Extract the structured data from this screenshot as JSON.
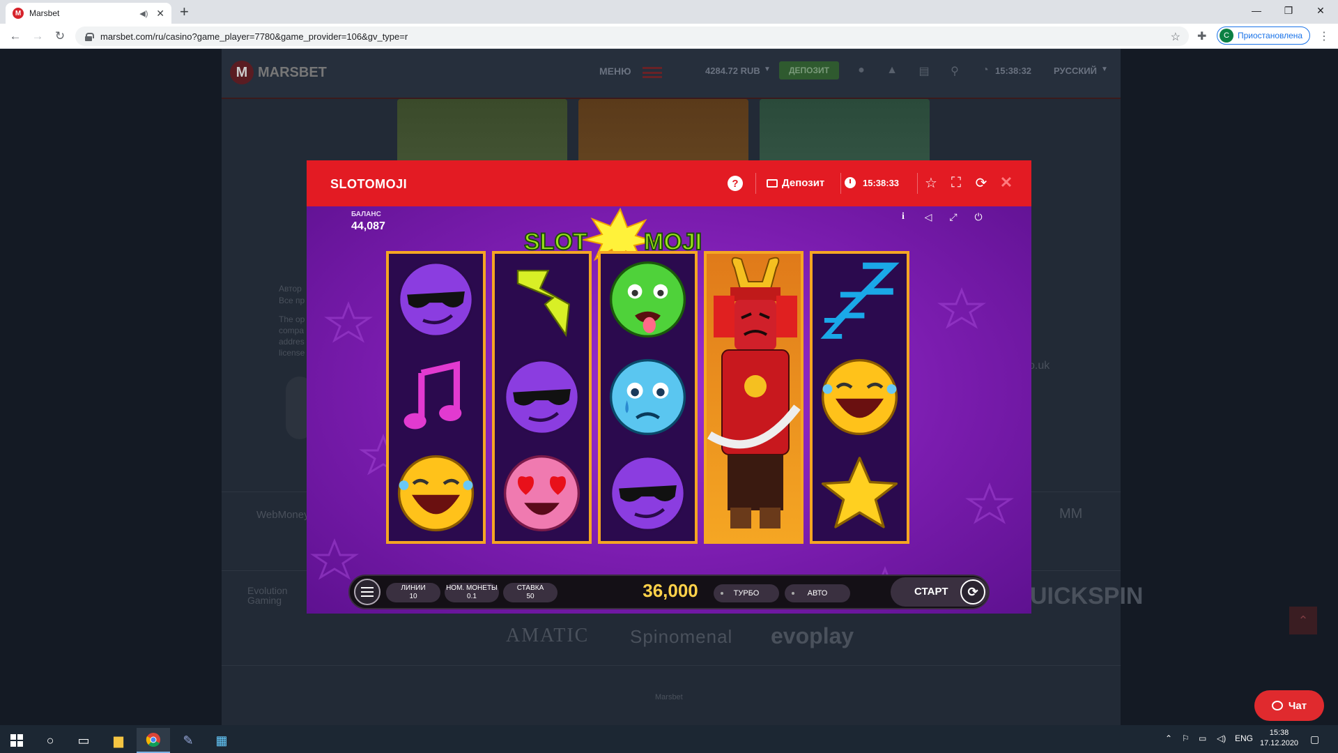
{
  "browser": {
    "tab_title": "Marsbet",
    "url": "marsbet.com/ru/casino?game_player=7780&game_provider=106&gv_type=r",
    "profile_initial": "С",
    "profile_label": "Приостановлена"
  },
  "site": {
    "logo_text": "MARSBET",
    "menu_label": "МЕНЮ",
    "balance": "4284.72 RUB",
    "deposit_label": "ДЕПОЗИТ",
    "time": "15:38:32",
    "language": "РУССКИЙ",
    "footer_text_1": "Автор",
    "footer_text_2": "Все пр",
    "footer_text_3": "The op",
    "footer_text_4": "compa",
    "footer_text_5": "addres",
    "footer_text_6": "license",
    "partner_webmoney": "WebMoney",
    "partner_evolution": "Evolution Gaming",
    "partner_amatic": "AMATIC",
    "partner_spinomenal": "Spinomenal",
    "partner_evoplay": "evoplay",
    "partner_quickspin": "UICKSPIN",
    "partner_gambling": "o.uk",
    "footer_brand": "Marsbet",
    "chat_label": "Чат"
  },
  "modal": {
    "title": "SLOTOMOJI",
    "deposit_label": "Депозит",
    "time": "15:38:33"
  },
  "game": {
    "balance_label": "БАЛАНС",
    "balance_value": "44,087",
    "logo_left": "SLOT",
    "logo_right": "MOJI",
    "lines_label": "ЛИНИИ",
    "lines_value": "10",
    "coin_label": "НОМ. МОНЕТЫ",
    "coin_value": "0.1",
    "bet_label": "СТАВКА",
    "bet_value": "50",
    "win_value": "36,000",
    "turbo_label": "ТУРБО",
    "auto_label": "АВТО",
    "start_label": "СТАРТ",
    "reels": [
      [
        "cool-emoji",
        "music-note",
        "laughing-emoji"
      ],
      [
        "lightning",
        "cool-emoji",
        "heart-eyes-emoji"
      ],
      [
        "sick-emoji",
        "crying-emoji",
        "cool-emoji"
      ],
      [
        "samurai-wild",
        "samurai-wild",
        "samurai-wild"
      ],
      [
        "sleeping-zzz",
        "laughing-emoji",
        "star"
      ]
    ]
  },
  "taskbar": {
    "lang": "ENG",
    "time": "15:38",
    "date": "17.12.2020"
  }
}
